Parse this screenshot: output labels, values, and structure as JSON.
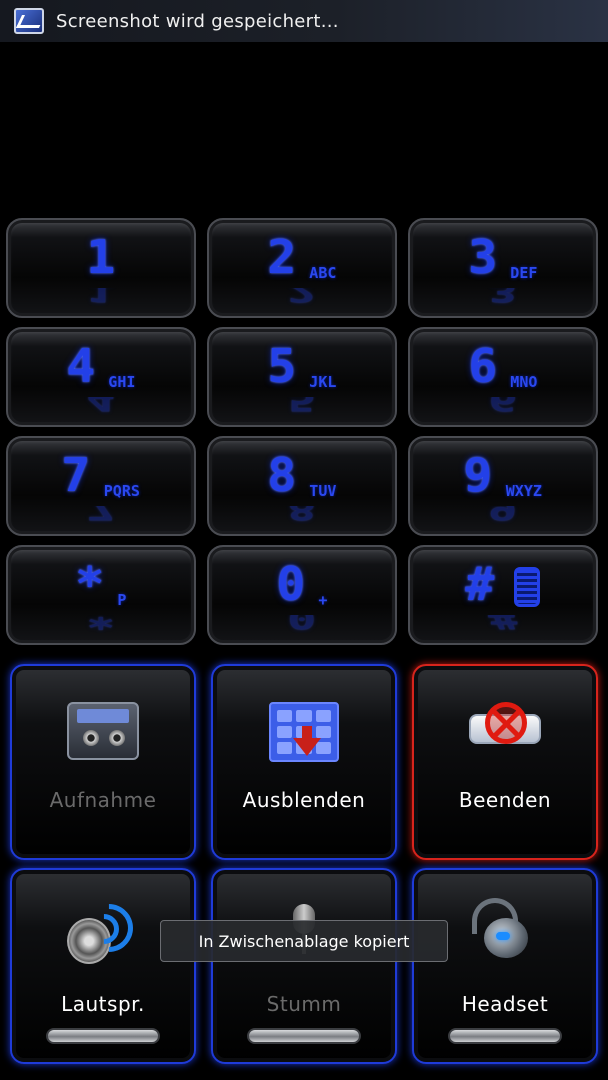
{
  "statusbar": {
    "notification_text": "Screenshot wird gespeichert...",
    "icon": "screenshot-icon"
  },
  "keypad": {
    "keys": [
      {
        "digit": "1",
        "letters": ""
      },
      {
        "digit": "2",
        "letters": "ABC"
      },
      {
        "digit": "3",
        "letters": "DEF"
      },
      {
        "digit": "4",
        "letters": "GHI"
      },
      {
        "digit": "5",
        "letters": "JKL"
      },
      {
        "digit": "6",
        "letters": "MNO"
      },
      {
        "digit": "7",
        "letters": "PQRS"
      },
      {
        "digit": "8",
        "letters": "TUV"
      },
      {
        "digit": "9",
        "letters": "WXYZ"
      },
      {
        "digit": "*",
        "letters": "P"
      },
      {
        "digit": "0",
        "letters": "+"
      },
      {
        "digit": "#",
        "letters": ""
      }
    ],
    "accent_color": "#2340e8"
  },
  "actions": {
    "record": {
      "label": "Aufnahme",
      "icon": "cassette-icon",
      "enabled": false
    },
    "hide": {
      "label": "Ausblenden",
      "icon": "hide-keypad-icon",
      "enabled": true
    },
    "quit": {
      "label": "Beenden",
      "icon": "end-call-icon",
      "enabled": true
    },
    "speaker": {
      "label": "Lautspr.",
      "icon": "speaker-icon",
      "enabled": true
    },
    "mute": {
      "label": "Stumm",
      "icon": "microphone-icon",
      "enabled": false
    },
    "headset": {
      "label": "Headset",
      "icon": "headset-icon",
      "enabled": true
    }
  },
  "toast": {
    "text": "In Zwischenablage kopiert"
  },
  "colors": {
    "tile_border_blue": "#1f3bd8",
    "tile_border_red": "#d8241c",
    "speaker_wave": "#1c7ee8"
  }
}
